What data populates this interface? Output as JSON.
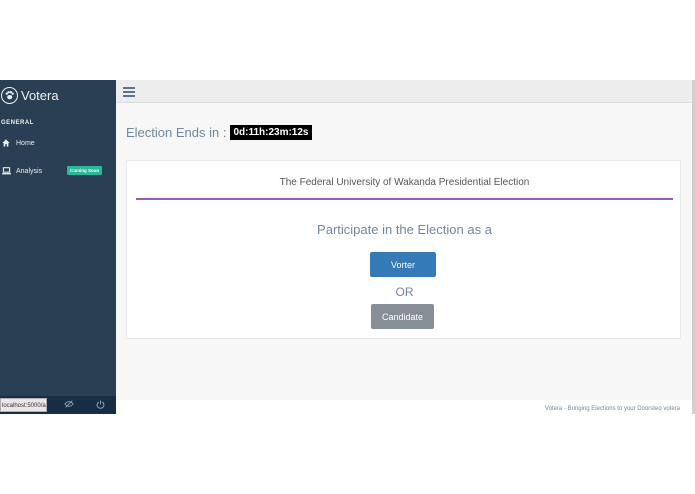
{
  "sidebar": {
    "brand": "Votera",
    "section_title": "GENERAL",
    "items": [
      {
        "label": "Home",
        "icon": "home-icon"
      },
      {
        "label": "Analysis",
        "icon": "laptop-icon",
        "badge": "Coming Soon"
      }
    ],
    "status_url": "localhost:5000/a"
  },
  "countdown": {
    "label": "Election Ends in :",
    "value": "0d:11h:23m:12s"
  },
  "panel": {
    "title": "The Federal University of Wakanda Presidential Election",
    "prompt": "Participate in the Election as a",
    "voter_button": "Vorter",
    "or_text": "OR",
    "candidate_button": "Candidate"
  },
  "footer": {
    "text": "Votera - Bringing Elections to your Doorsteo votera"
  },
  "colors": {
    "sidebar": "#2a3f54",
    "accent_rule": "#9b59b6",
    "primary": "#337ab7",
    "secondary": "#868e96",
    "badge": "#26b99a"
  }
}
